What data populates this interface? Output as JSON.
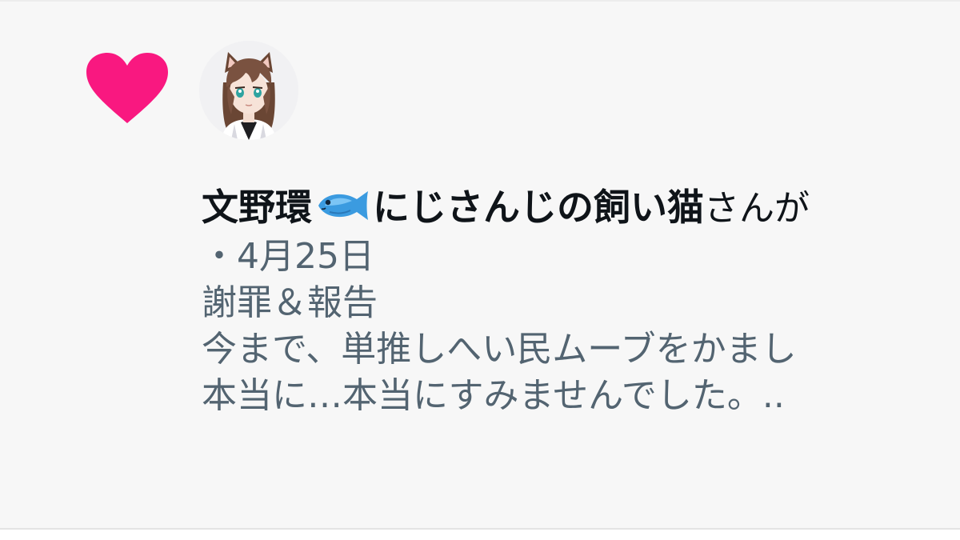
{
  "notification": {
    "user_name_part1": "文野環",
    "emoji_icon": "fish-icon",
    "user_name_part2": "にじさんじの飼い猫",
    "action_text": "さんが",
    "date_separator": "・",
    "date": "4月25日",
    "tweet_title": "謝罪＆報告",
    "tweet_line1": "今まで、単推しへい民ムーブをかまし",
    "tweet_line2": "本当に…本当にすみませんでした。.."
  },
  "colors": {
    "heart": "#f91880",
    "background": "#f7f7f7",
    "primary_text": "#0f1419",
    "secondary_text": "#536471"
  }
}
